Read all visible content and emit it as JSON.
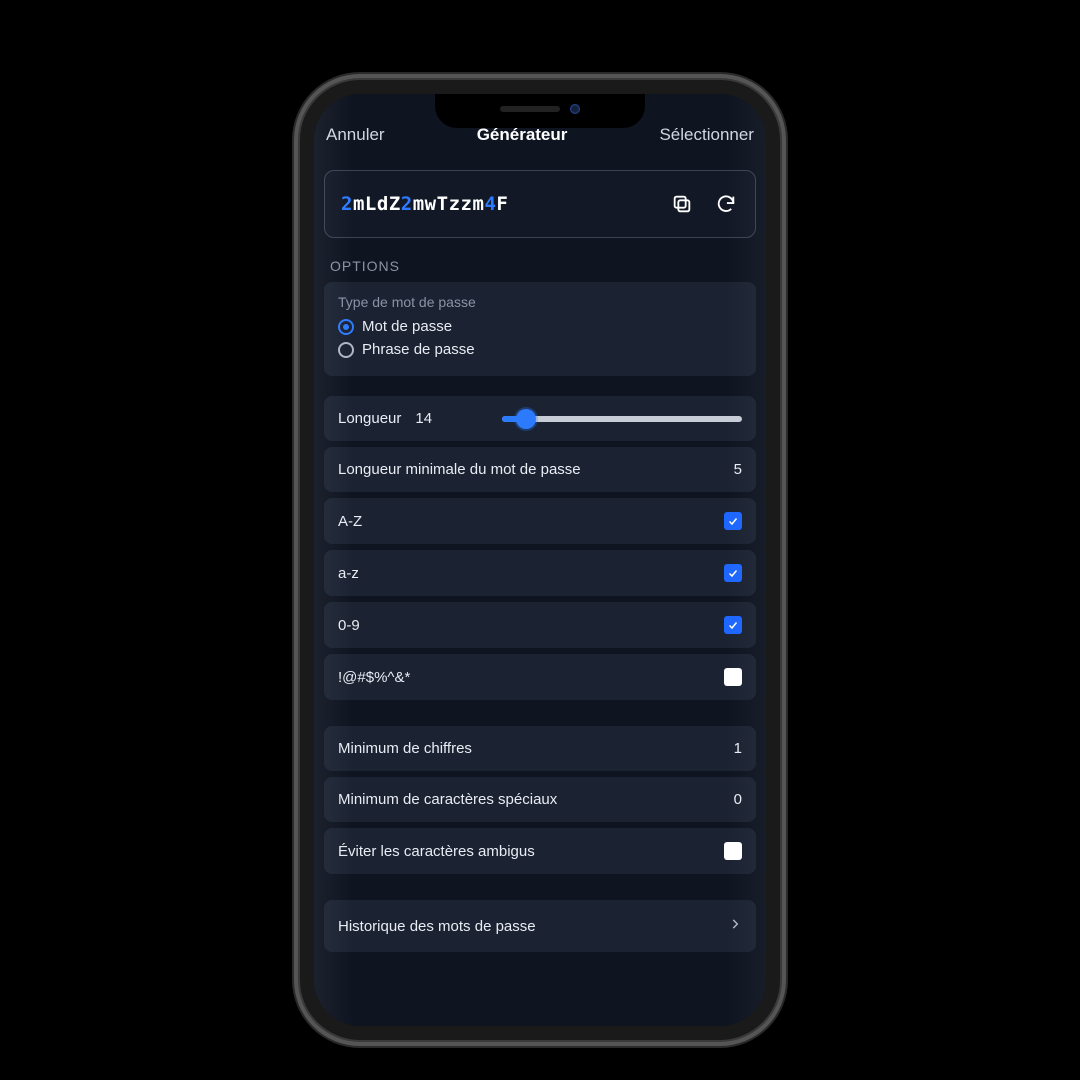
{
  "header": {
    "cancel": "Annuler",
    "title": "Générateur",
    "select": "Sélectionner"
  },
  "password": {
    "chars": [
      {
        "c": "2",
        "t": "d"
      },
      {
        "c": "m",
        "t": "l"
      },
      {
        "c": "L",
        "t": "l"
      },
      {
        "c": "d",
        "t": "l"
      },
      {
        "c": "Z",
        "t": "l"
      },
      {
        "c": "2",
        "t": "d"
      },
      {
        "c": "m",
        "t": "l"
      },
      {
        "c": "w",
        "t": "l"
      },
      {
        "c": "T",
        "t": "l"
      },
      {
        "c": "z",
        "t": "l"
      },
      {
        "c": "z",
        "t": "l"
      },
      {
        "c": "m",
        "t": "l"
      },
      {
        "c": "4",
        "t": "d"
      },
      {
        "c": "F",
        "t": "l"
      }
    ],
    "copy_icon": "copy-icon",
    "regen_icon": "refresh-icon"
  },
  "options": {
    "section_label": "OPTIONS",
    "type_group_title": "Type de mot de passe",
    "type_password": "Mot de passe",
    "type_passphrase": "Phrase de passe",
    "type_selected": "password"
  },
  "rows": {
    "length_label": "Longueur",
    "length_value": "14",
    "slider_percent": 10,
    "minlen_label": "Longueur minimale du mot de passe",
    "minlen_value": "5",
    "upper_label": "A-Z",
    "upper_on": true,
    "lower_label": "a-z",
    "lower_on": true,
    "digits_label": "0-9",
    "digits_on": true,
    "special_label": "!@#$%^&*",
    "special_on": false,
    "min_digits_label": "Minimum de chiffres",
    "min_digits_value": "1",
    "min_special_label": "Minimum de caractères spéciaux",
    "min_special_value": "0",
    "avoid_ambig_label": "Éviter les caractères ambigus",
    "avoid_ambig_on": false,
    "history_label": "Historique des mots de passe"
  },
  "colors": {
    "accent": "#2c7bff",
    "card": "#1b2232",
    "bg": "#0e1420"
  }
}
